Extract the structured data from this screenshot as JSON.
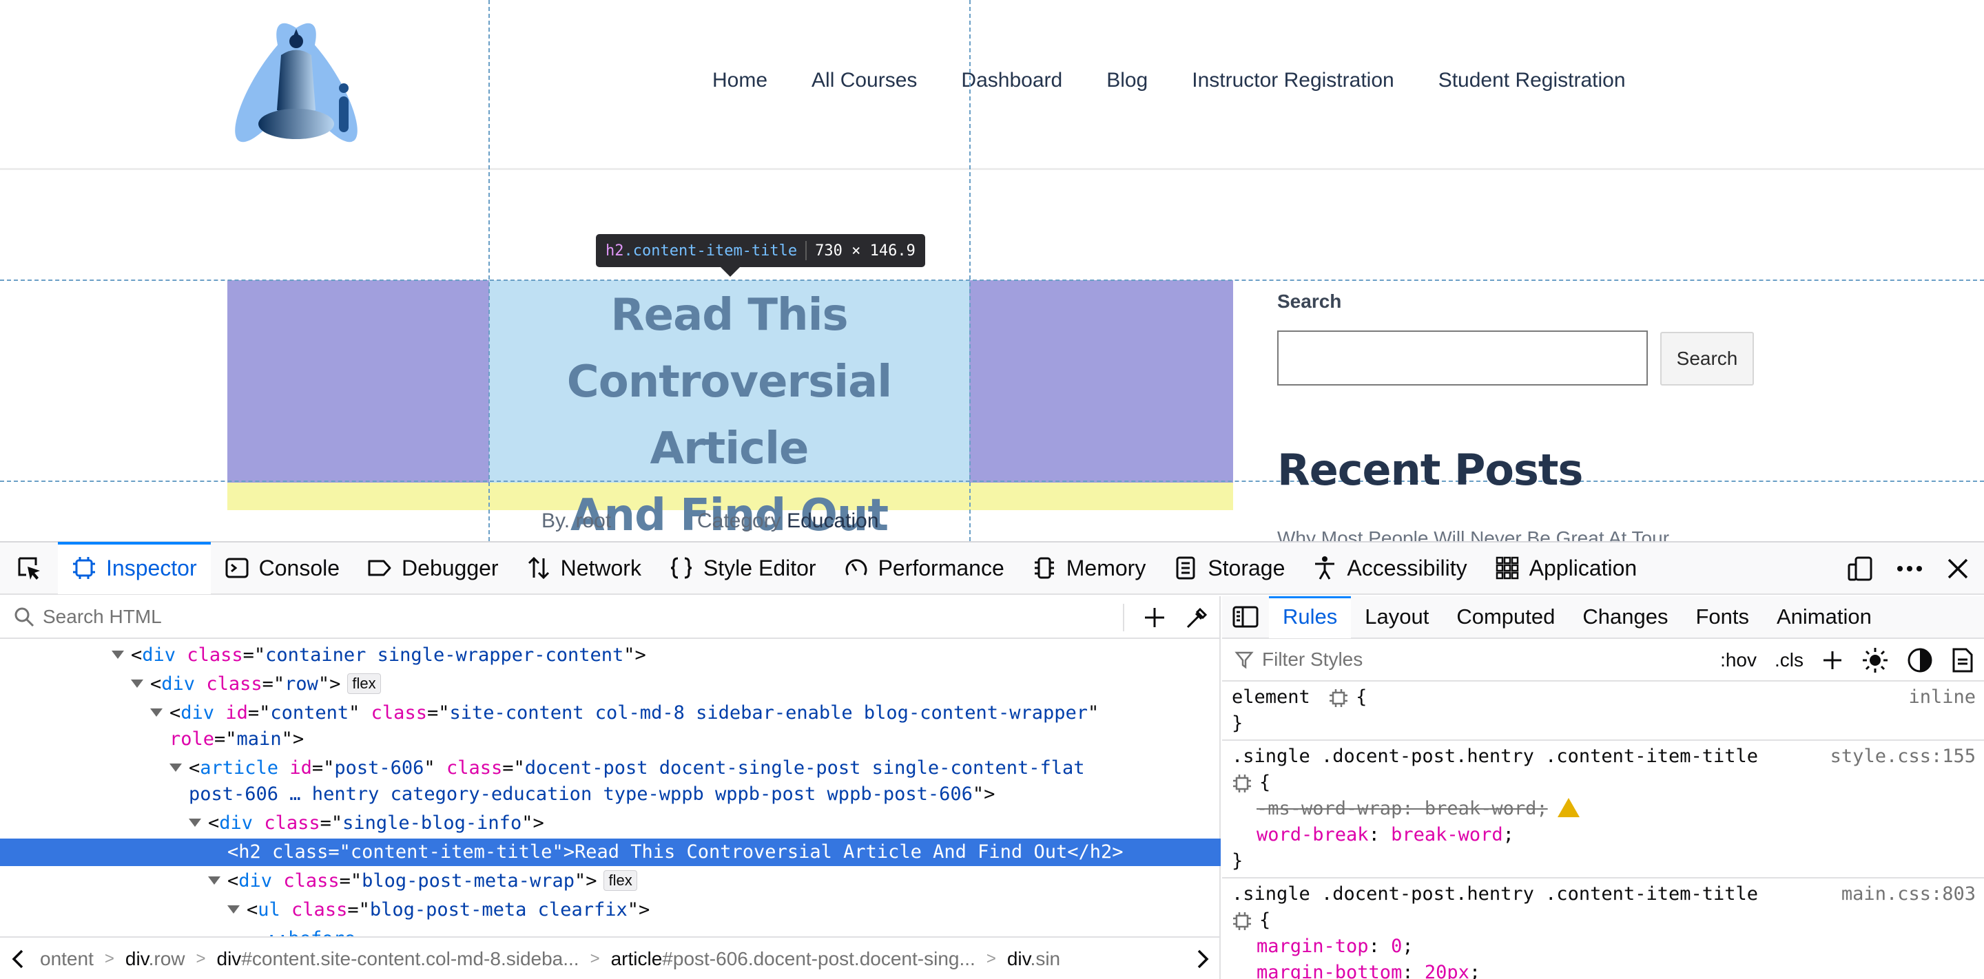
{
  "site": {
    "nav": [
      "Home",
      "All Courses",
      "Dashboard",
      "Blog",
      "Instructor Registration",
      "Student Registration"
    ],
    "post_title_lines": [
      "Read This",
      "Controversial Article",
      "And Find Out"
    ],
    "meta_by": "By. root",
    "meta_category_label": "Category",
    "meta_category_value": "Education",
    "sidebar": {
      "search_label": "Search",
      "search_button": "Search",
      "recent_title": "Recent Posts",
      "recent_first": "Why Most People Will Never Be Great At Tour"
    },
    "highlighter_tooltip": {
      "tag": "h2",
      "class": ".content-item-title",
      "size": "730 × 146.9"
    },
    "colors": {
      "nav_text": "#24344d",
      "highlight_margin": "#a19fdd",
      "highlight_content": "#bfe0f3",
      "highlight_bottom": "#f6f6a6"
    }
  },
  "devtools": {
    "tabs": [
      {
        "label": "Inspector",
        "icon": "inspector-icon",
        "active": true
      },
      {
        "label": "Console",
        "icon": "console-icon"
      },
      {
        "label": "Debugger",
        "icon": "debugger-icon"
      },
      {
        "label": "Network",
        "icon": "network-icon"
      },
      {
        "label": "Style Editor",
        "icon": "style-editor-icon"
      },
      {
        "label": "Performance",
        "icon": "performance-icon"
      },
      {
        "label": "Memory",
        "icon": "memory-icon"
      },
      {
        "label": "Storage",
        "icon": "storage-icon"
      },
      {
        "label": "Accessibility",
        "icon": "accessibility-icon"
      },
      {
        "label": "Application",
        "icon": "application-icon"
      }
    ],
    "html_search_placeholder": "Search HTML",
    "tree": {
      "l1": {
        "tag": "div",
        "attr": "class",
        "val": "container single-wrapper-content"
      },
      "l2": {
        "tag": "div",
        "attr": "class",
        "val": "row",
        "badge": "flex"
      },
      "l3": {
        "tag": "div",
        "attr1": "id",
        "val1": "content",
        "attr2": "class",
        "val2": "site-content col-md-8 sidebar-enable blog-content-wrapper"
      },
      "l3b": {
        "attr": "role",
        "val": "main"
      },
      "l4": {
        "tag": "article",
        "attr1": "id",
        "val1": "post-606",
        "attr2": "class",
        "val2": "docent-post docent-single-post single-content-flat"
      },
      "l4b": {
        "val": "post-606 … hentry category-education type-wppb wppb-post wppb-post-606"
      },
      "l5": {
        "tag": "div",
        "attr": "class",
        "val": "single-blog-info"
      },
      "l6": {
        "tag": "h2",
        "attr": "class",
        "val": "content-item-title",
        "text": "Read This Controversial Article And Find Out",
        "close": "h2"
      },
      "l7": {
        "tag": "div",
        "attr": "class",
        "val": "blog-post-meta-wrap",
        "badge": "flex"
      },
      "l8": {
        "tag": "ul",
        "attr": "class",
        "val": "blog-post-meta clearfix"
      },
      "l9": {
        "text": "::before"
      }
    },
    "breadcrumbs": [
      {
        "tag": "",
        "cls": "ontent"
      },
      {
        "tag": "div",
        "cls": ".row"
      },
      {
        "tag": "div",
        "cls": "#content.site-content.col-md-8.sideba..."
      },
      {
        "tag": "article",
        "cls": "#post-606.docent-post.docent-sing..."
      },
      {
        "tag": "div",
        "cls": ".sin"
      }
    ],
    "rules_tabs": [
      "Rules",
      "Layout",
      "Computed",
      "Changes",
      "Fonts",
      "Animation"
    ],
    "filter_placeholder": "Filter Styles",
    "filter_buttons": {
      "hov": ":hov",
      "cls": ".cls"
    },
    "rules": {
      "r1": {
        "selector": "element",
        "source": "inline"
      },
      "r2": {
        "selector": ".single .docent-post.hentry .content-item-title",
        "source": "style.css:155",
        "p1_name": "-ms-word-wrap",
        "p1_val": "break-word",
        "p2_name": "word-break",
        "p2_val": "break-word"
      },
      "r3": {
        "selector": ".single .docent-post.hentry .content-item-title",
        "source": "main.css:803",
        "p1_name": "margin-top",
        "p1_val": "0",
        "p2_name": "margin-bottom",
        "p2_val": "20px"
      }
    }
  }
}
